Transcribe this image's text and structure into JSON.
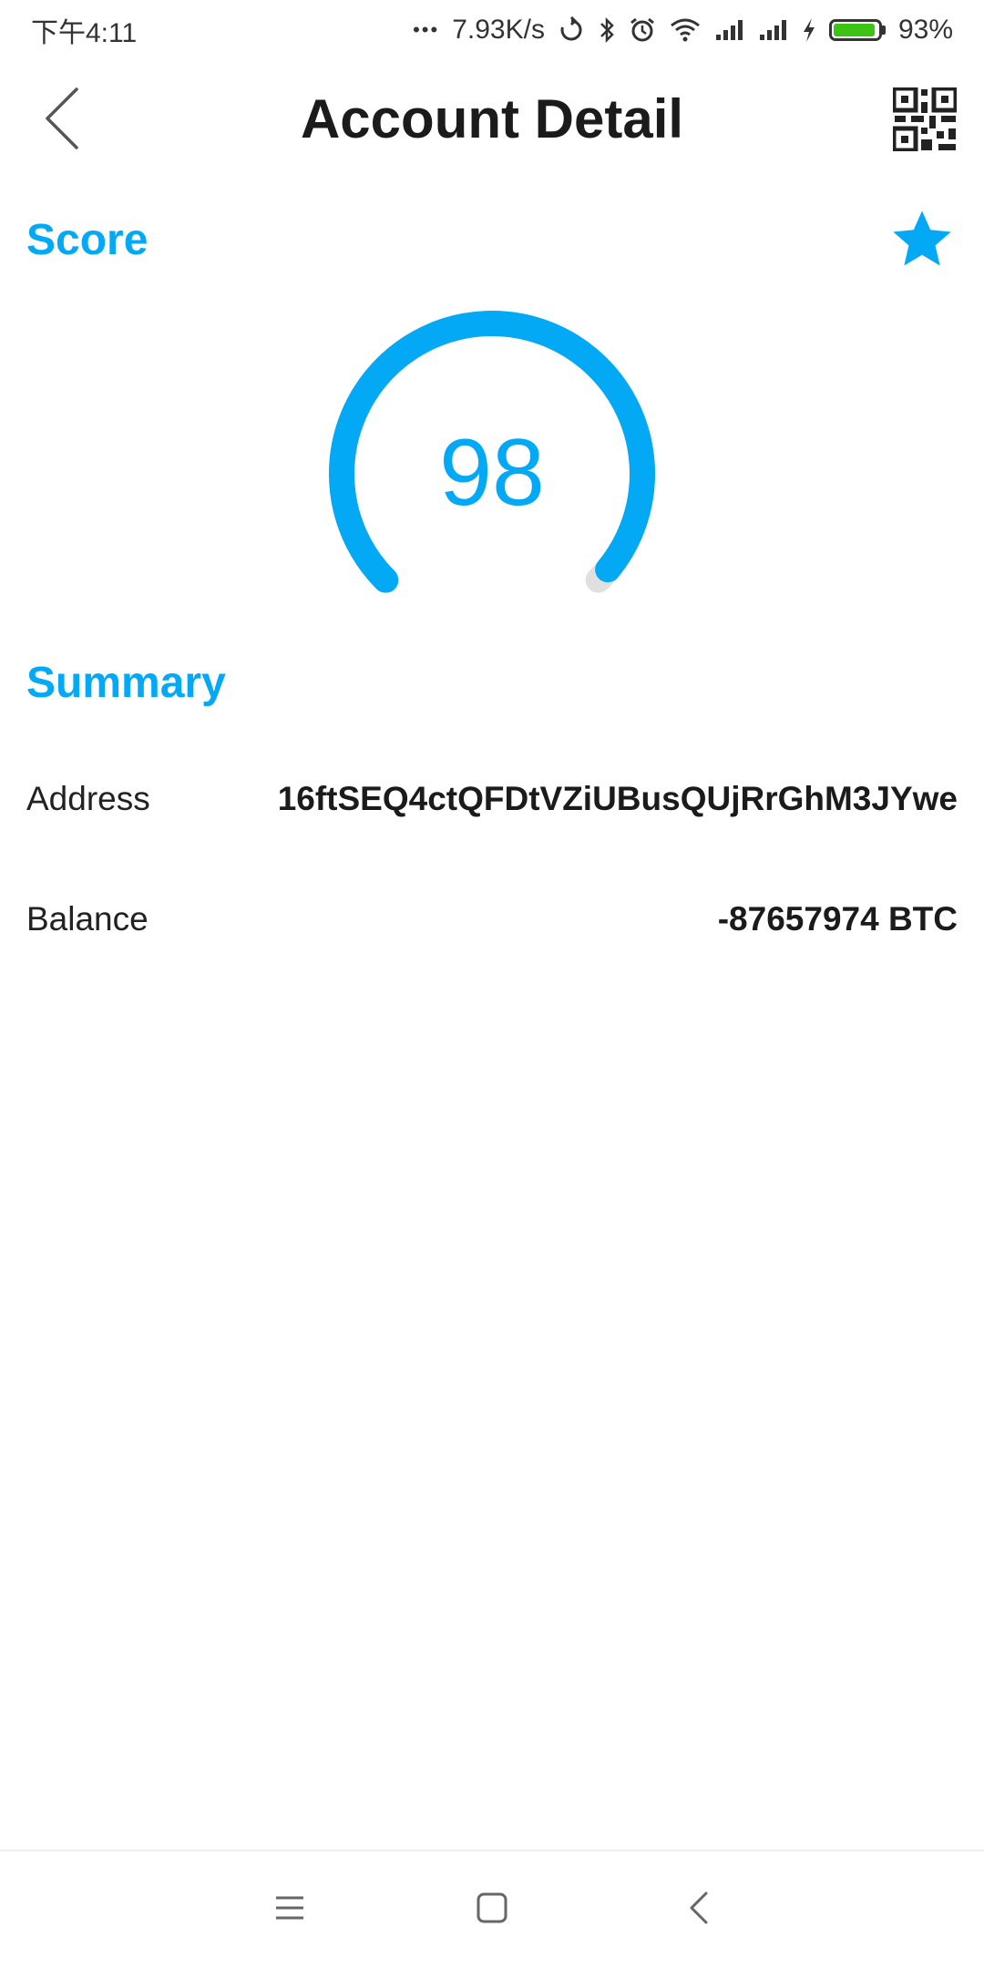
{
  "status_bar": {
    "time": "下午4:11",
    "dots": "•••",
    "network_speed": "7.93K/s",
    "battery_percent": "93%",
    "battery_level": 0.93,
    "icons": [
      "sync-icon",
      "bluetooth-icon",
      "alarm-icon",
      "wifi-icon",
      "signal-icon",
      "signal-icon-2",
      "charging-icon",
      "battery-icon"
    ]
  },
  "header": {
    "title": "Account Detail",
    "back_icon": "chevron-left-icon",
    "qr_icon": "qr-code-icon"
  },
  "score": {
    "heading": "Score",
    "value": "98",
    "gauge_fraction": 0.98,
    "favorite_icon": "star-icon"
  },
  "summary": {
    "heading": "Summary",
    "rows": [
      {
        "label": "Address",
        "value": "16ftSEQ4ctQFDtVZiUBusQUjRrGhM3JYwe"
      },
      {
        "label": "Balance",
        "value": "-87657974 BTC"
      }
    ]
  },
  "nav": {
    "menu_icon": "menu-icon",
    "home_icon": "home-square-icon",
    "back_icon": "back-chevron-icon"
  },
  "colors": {
    "accent": "#03a9f4",
    "track": "#e0e0e0",
    "battery": "#3cc314"
  }
}
